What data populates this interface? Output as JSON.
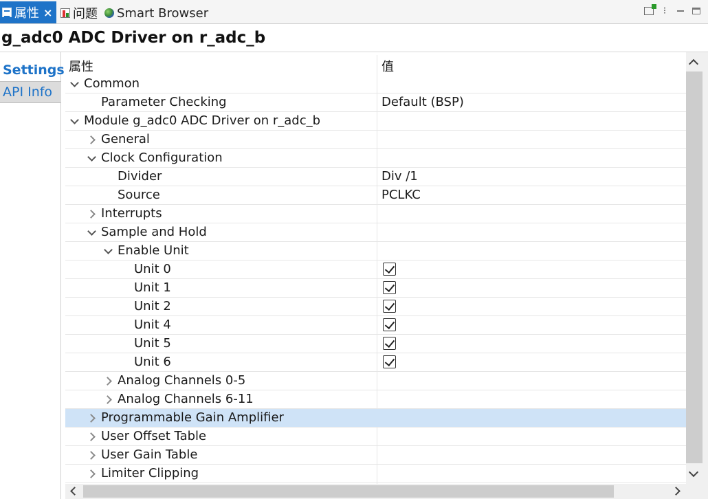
{
  "tabs": {
    "properties": "属性",
    "problems": "问题",
    "smart_browser": "Smart Browser",
    "close_glyph": "×"
  },
  "window_controls": {
    "menu_glyph": "⁝"
  },
  "title": "g_adc0 ADC Driver on r_adc_b",
  "side_tabs": {
    "settings": "Settings",
    "api_info": "API Info"
  },
  "table": {
    "header_property": "属性",
    "header_value": "值",
    "rows": [
      {
        "label": "Common",
        "value": ""
      },
      {
        "label": "Parameter Checking",
        "value": "Default (BSP)"
      },
      {
        "label": "Module g_adc0 ADC Driver on r_adc_b",
        "value": ""
      },
      {
        "label": "General",
        "value": ""
      },
      {
        "label": "Clock Configuration",
        "value": ""
      },
      {
        "label": "Divider",
        "value": "Div /1"
      },
      {
        "label": "Source",
        "value": "PCLKC"
      },
      {
        "label": "Interrupts",
        "value": ""
      },
      {
        "label": "Sample and Hold",
        "value": ""
      },
      {
        "label": "Enable Unit",
        "value": ""
      },
      {
        "label": "Unit 0",
        "checked": true
      },
      {
        "label": "Unit 1",
        "checked": true
      },
      {
        "label": "Unit 2",
        "checked": true
      },
      {
        "label": "Unit 4",
        "checked": true
      },
      {
        "label": "Unit 5",
        "checked": true
      },
      {
        "label": "Unit 6",
        "checked": true
      },
      {
        "label": "Analog Channels 0-5",
        "value": ""
      },
      {
        "label": "Analog Channels 6-11",
        "value": ""
      },
      {
        "label": "Programmable Gain Amplifier",
        "value": "",
        "selected": true
      },
      {
        "label": "User Offset Table",
        "value": ""
      },
      {
        "label": "User Gain Table",
        "value": ""
      },
      {
        "label": "Limiter Clipping",
        "value": ""
      }
    ]
  }
}
